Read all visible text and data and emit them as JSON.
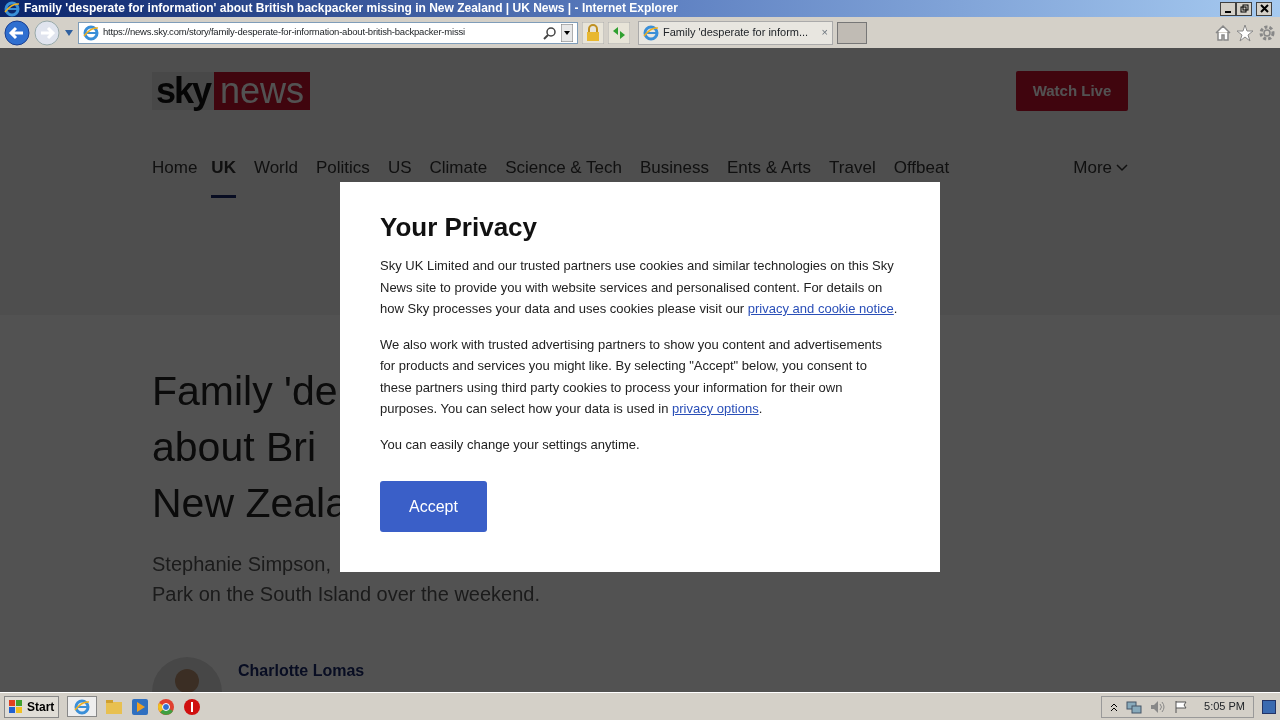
{
  "browser": {
    "title": "Family 'desperate for information' about British backpacker missing in New Zealand | UK News |  - Internet Explorer",
    "address": "https://news.sky.com/story/family-desperate-for-information-about-british-backpacker-missi",
    "tab_title": "Family 'desperate for inform...",
    "tab_close": "×"
  },
  "site": {
    "logo_left": "sky",
    "logo_right": "news",
    "watch_live": "Watch Live",
    "nav": [
      {
        "label": "Home",
        "selected": false
      },
      {
        "label": "UK",
        "selected": true
      },
      {
        "label": "World",
        "selected": false
      },
      {
        "label": "Politics",
        "selected": false
      },
      {
        "label": "US",
        "selected": false
      },
      {
        "label": "Climate",
        "selected": false
      },
      {
        "label": "Science & Tech",
        "selected": false
      },
      {
        "label": "Business",
        "selected": false
      },
      {
        "label": "Ents & Arts",
        "selected": false
      },
      {
        "label": "Travel",
        "selected": false
      },
      {
        "label": "Offbeat",
        "selected": false
      }
    ],
    "more": "More"
  },
  "article": {
    "headline_lines": [
      "Family 'de",
      "about Bri",
      "New Zeala"
    ],
    "standfirst_lines": [
      "Stephanie Simpson,",
      "Park on the South Island over the weekend."
    ],
    "author": "Charlotte Lomas"
  },
  "dialog": {
    "title": "Your Privacy",
    "paragraphs": [
      {
        "text": "Sky UK Limited and our trusted partners use cookies and similar technologies on this Sky News site to provide you with website services and personalised content. For details on how Sky processes your data and uses cookies please visit our ",
        "link": "privacy and cookie notice",
        "after": "."
      },
      {
        "text": "We also work with trusted advertising partners to show you content and advertisements for products and services you might like. By selecting \"Accept\" below, you consent to these partners using third party cookies to process your information for their own purposes. You can select how your data is used in ",
        "link": "privacy options",
        "after": "."
      },
      {
        "text": "You can easily change your settings anytime."
      }
    ],
    "button": "Accept"
  },
  "taskbar": {
    "start": "Start",
    "clock": "5:05 PM"
  }
}
